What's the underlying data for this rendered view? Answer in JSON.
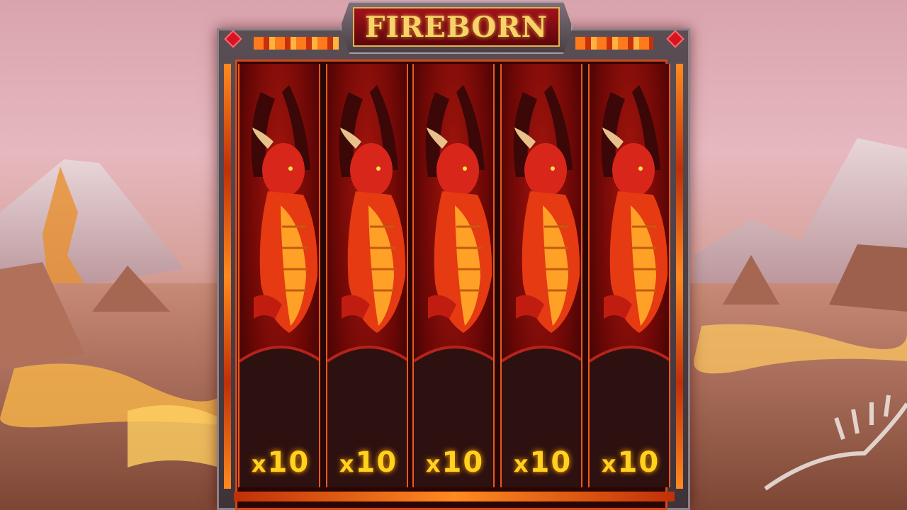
{
  "game": {
    "title": "FIREBORN"
  },
  "reels": [
    {
      "symbol": "red-dragon",
      "multiplier_prefix": "x",
      "multiplier_value": "10"
    },
    {
      "symbol": "red-dragon",
      "multiplier_prefix": "x",
      "multiplier_value": "10"
    },
    {
      "symbol": "red-dragon",
      "multiplier_prefix": "x",
      "multiplier_value": "10"
    },
    {
      "symbol": "red-dragon",
      "multiplier_prefix": "x",
      "multiplier_value": "10"
    },
    {
      "symbol": "red-dragon",
      "multiplier_prefix": "x",
      "multiplier_value": "10"
    }
  ],
  "colors": {
    "accent_gold": "#ffd21f",
    "frame_red": "#d4471a",
    "sky_pink": "#e6b8bf"
  }
}
